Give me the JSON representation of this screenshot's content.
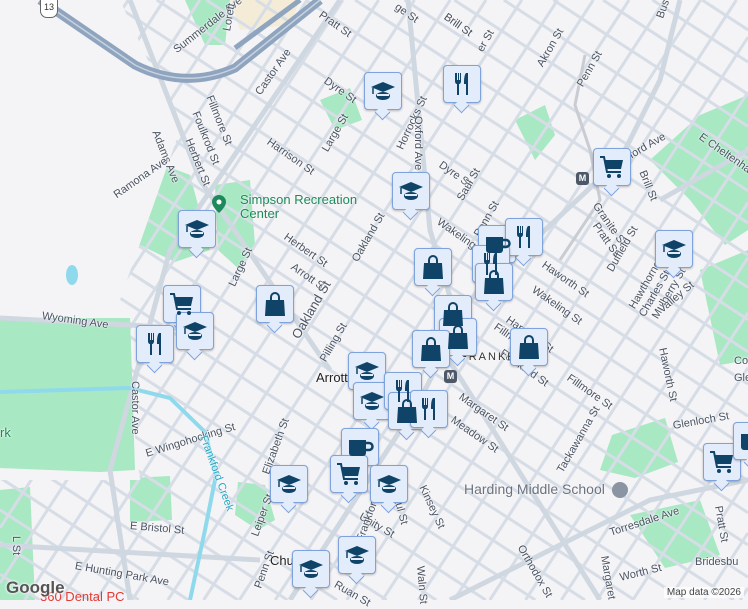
{
  "map": {
    "route_shield": "13",
    "labels": [
      "Pratt St",
      "Summerdale Ave",
      "Lorett",
      "Castor Ave",
      "Dyre St",
      "Fillmore St",
      "Foulkrod St",
      "Herbert St",
      "Adams Ave",
      "Ramona Ave",
      "Harrison St",
      "Large St",
      "Horrocks St",
      "Oxford Ave",
      "Dyre St",
      "Saul St",
      "Oakland St",
      "Herbert St",
      "Arrott St",
      "Large St",
      "Oakland St",
      "Pilling St",
      "Wyoming Ave",
      "Castor Ave",
      "Brill St",
      "Akron St",
      "Penn St",
      "E Cheltenham",
      "ford Ave",
      "Brill St",
      "Granite St",
      "Pratt St",
      "Duffield St",
      "Hawthorne St",
      "Mulberry St",
      "Charles St",
      "Valley St",
      "Wakeling St",
      "Penn St",
      "Haworth St",
      "Wakeling St",
      "Harrison St",
      "Fillmore St",
      "Foulkrod St",
      "Margaret St",
      "Meadow St",
      "Fillmore St",
      "Tackawanna St",
      "Haworth St",
      "Glenloch St",
      "Torresdale Ave",
      "Orthodox St",
      "Margaret",
      "Worth St",
      "Bridesbu",
      "Pratt St",
      "E Wingohocking St",
      "Frankford Creek",
      "Elizabeth St",
      "E Bristol St",
      "L St",
      "E Hunting Park Ave",
      "Leiper St",
      "Penn St",
      "Ruan St",
      "Unity St",
      "Paul St",
      "Kinsey St",
      "Waln St",
      "Frankford Ave",
      "Arrott",
      "FRANKFORD",
      "Church",
      "rk",
      "Bus",
      "Col",
      "Gle",
      "ge St",
      "Brill St",
      "er St"
    ],
    "pois": {
      "rec_center": "Simpson Recreation Center",
      "school": "Harding Middle School",
      "dental": "360 Dental PC"
    },
    "metro_label": "M",
    "markers": [
      "school",
      "restaurant",
      "school",
      "grocery",
      "school",
      "school",
      "grocery",
      "school",
      "restaurant",
      "shopping",
      "shopping",
      "cafe",
      "restaurant",
      "restaurant",
      "shopping",
      "shopping",
      "shopping",
      "shopping",
      "shopping",
      "school",
      "school",
      "restaurant",
      "shopping",
      "restaurant",
      "cafe",
      "grocery",
      "school",
      "school",
      "school",
      "school",
      "grocery",
      "cafe"
    ],
    "google_logo": "Google",
    "attribution": "Map data ©2026",
    "colors": {
      "park": "#a8e8c3",
      "road": "#d3dbe4",
      "highway": "#8fa4bf",
      "water": "#8fd9ec",
      "marker_bg": "#e3ecfb",
      "icon": "#0f4468"
    }
  }
}
